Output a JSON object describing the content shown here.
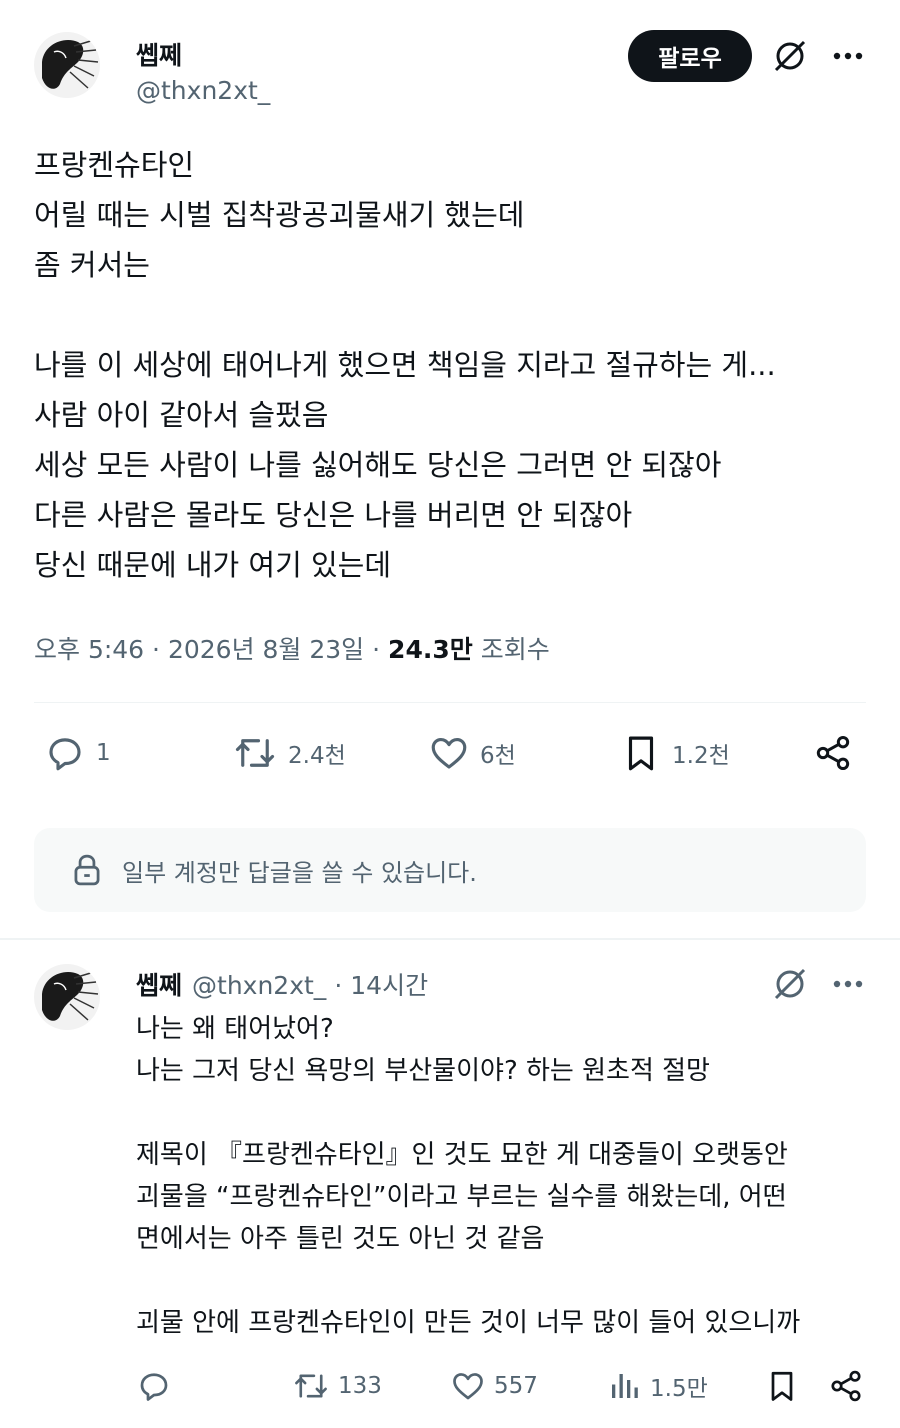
{
  "tweet": {
    "author_name": "쎕쩨",
    "author_handle": "@thxn2xt_",
    "follow_label": "팔로우",
    "lines": [
      "프랑켄슈타인",
      "어릴 때는 시벌 집착광공괴물새기 했는데",
      "좀 커서는",
      "",
      "나를 이 세상에 태어나게 했으면 책임을 지라고 절규하는 게...",
      "사람 아이 같아서 슬펐음",
      "세상 모든 사람이 나를 싫어해도 당신은 그러면 안 되잖아",
      "다른 사람은 몰라도 당신은 나를 버리면 안 되잖아",
      "당신 때문에 내가 여기 있는데"
    ],
    "time": "오후 5:46",
    "date": "2026년 8월 23일",
    "views_count": "24.3만",
    "views_label": "조회수",
    "replies": "1",
    "retweets": "2.4천",
    "likes": "6천",
    "bookmarks": "1.2천",
    "reply_restriction": "일부 계정만 답글을 쓸 수 있습니다."
  },
  "reply": {
    "author_name": "쎕쩨",
    "author_handle": "@thxn2xt_",
    "time_ago": "14시간",
    "lines": [
      "나는 왜 태어났어?",
      "나는 그저 당신 욕망의 부산물이야? 하는 원초적 절망",
      "",
      "제목이 『프랑켄슈타인』인 것도 묘한 게 대중들이 오랫동안",
      "괴물을 “프랑켄슈타인”이라고 부르는 실수를 해왔는데, 어떤",
      "면에서는 아주 틀린 것도 아닌 것 같음",
      "",
      "괴물 안에 프랑켄슈타인이 만든 것이 너무 많이 들어 있으니까"
    ],
    "retweets": "133",
    "likes": "557",
    "views": "1.5만"
  },
  "colors": {
    "text": "#0f1419",
    "secondary": "#536471",
    "divider": "#eff3f4",
    "notice_bg": "#f7f9f9"
  },
  "icons": [
    "grok-icon",
    "more-icon",
    "reply-icon",
    "retweet-icon",
    "like-icon",
    "bookmark-icon",
    "share-icon",
    "lock-icon",
    "views-icon"
  ]
}
